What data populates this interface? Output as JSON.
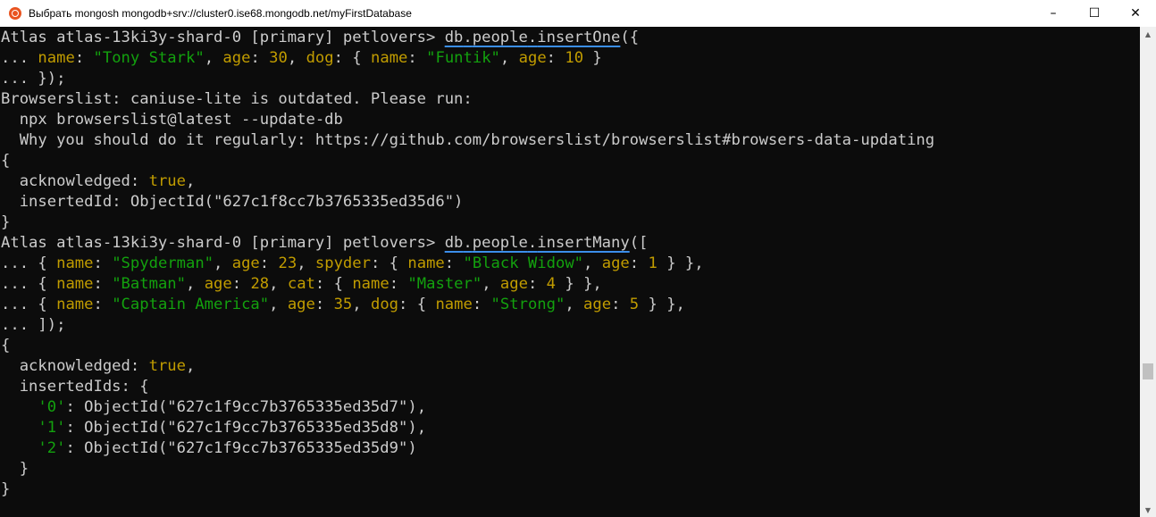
{
  "window": {
    "title": "Выбрать mongosh mongodb+srv://cluster0.ise68.mongodb.net/myFirstDatabase",
    "minimize": "–",
    "maximize": "☐",
    "close": "✕"
  },
  "scrollbar": {
    "up": "▲",
    "down": "▼"
  },
  "terminal": {
    "prompt": "Atlas atlas-13ki3y-shard-0 [primary] petlovers> ",
    "cmd1": {
      "obj": "db",
      "dot1": ".",
      "coll": "people",
      "dot2": ".",
      "method": "insertOne",
      "open": "({",
      "cont": "... ",
      "k_name": "name",
      "v_name": "\"Tony Stark\"",
      "k_age": "age",
      "v_age": "30",
      "k_dog": "dog",
      "k_dname": "name",
      "v_dname": "\"Funtik\"",
      "k_dage": "age",
      "v_dage": "10",
      "close": "... });"
    },
    "warning": {
      "line1": "Browserslist: caniuse-lite is outdated. Please run:",
      "line2": "  npx browserslist@latest --update-db",
      "line3": "  Why you should do it regularly: https://github.com/browserslist/browserslist#browsers-data-updating"
    },
    "result1": {
      "open": "{",
      "k_ack": "acknowledged",
      "v_ack": "true",
      "k_id": "insertedId",
      "v_id": "ObjectId(\"627c1f8cc7b3765335ed35d6\")",
      "close": "}"
    },
    "cmd2": {
      "obj": "db",
      "dot1": ".",
      "coll": "people",
      "dot2": ".",
      "method": "insertMany",
      "open": "([",
      "row1": {
        "k_name": "name",
        "v_name": "\"Spyderman\"",
        "k_age": "age",
        "v_age": "23",
        "k_obj": "spyder",
        "k_iname": "name",
        "v_iname": "\"Black Widow\"",
        "k_iage": "age",
        "v_iage": "1"
      },
      "row2": {
        "k_name": "name",
        "v_name": "\"Batman\"",
        "k_age": "age",
        "v_age": "28",
        "k_obj": "cat",
        "k_iname": "name",
        "v_iname": "\"Master\"",
        "k_iage": "age",
        "v_iage": "4"
      },
      "row3": {
        "k_name": "name",
        "v_name": "\"Captain America\"",
        "k_age": "age",
        "v_age": "35",
        "k_obj": "dog",
        "k_iname": "name",
        "v_iname": "\"Strong\"",
        "k_iage": "age",
        "v_iage": "5"
      },
      "close": "... ]);"
    },
    "result2": {
      "open": "{",
      "k_ack": "acknowledged",
      "v_ack": "true",
      "k_ids": "insertedIds",
      "ids": [
        {
          "key": "'0'",
          "val": "ObjectId(\"627c1f9cc7b3765335ed35d7\")"
        },
        {
          "key": "'1'",
          "val": "ObjectId(\"627c1f9cc7b3765335ed35d8\")"
        },
        {
          "key": "'2'",
          "val": "ObjectId(\"627c1f9cc7b3765335ed35d9\")"
        }
      ],
      "inner_close": "  }",
      "close": "}"
    }
  }
}
